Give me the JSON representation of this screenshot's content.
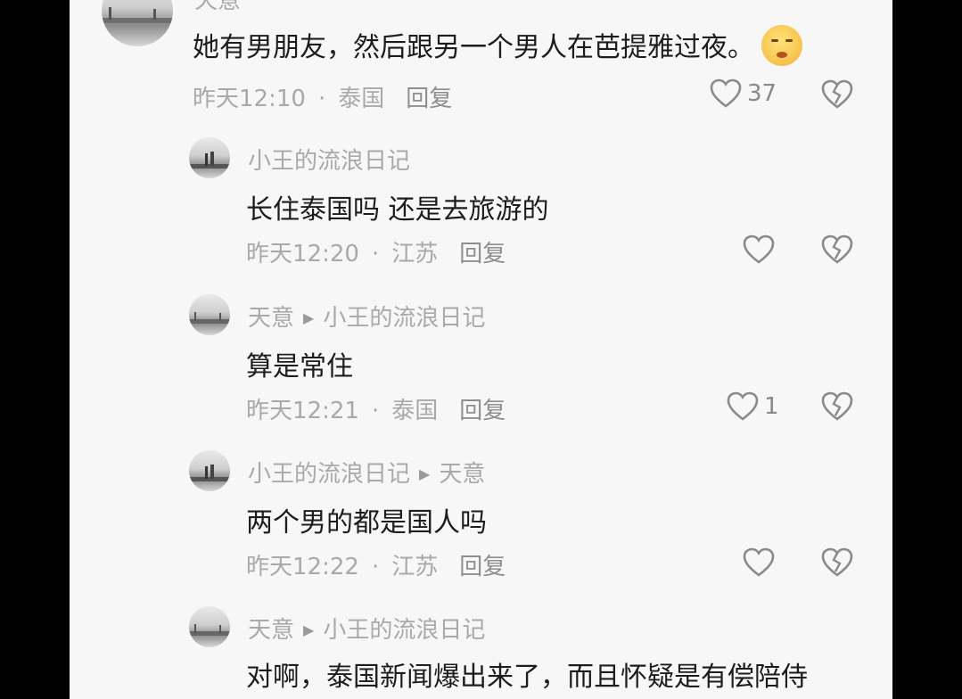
{
  "comments": [
    {
      "name": "天意",
      "text": "她有男朋友，然后跟另一个男人在芭提雅过夜。",
      "time": "昨天12:10",
      "location": "泰国",
      "reply": "回复",
      "likes": "37",
      "emoji": "grimace-emoji"
    },
    {
      "name": "小王的流浪日记",
      "text": "长住泰国吗 还是去旅游的",
      "time": "昨天12:20",
      "location": "江苏",
      "reply": "回复",
      "likes": ""
    },
    {
      "name": "天意",
      "reply_to": "小王的流浪日记",
      "text": "算是常住",
      "time": "昨天12:21",
      "location": "泰国",
      "reply": "回复",
      "likes": "1"
    },
    {
      "name": "小王的流浪日记",
      "reply_to": "天意",
      "text": "两个男的都是国人吗",
      "time": "昨天12:22",
      "location": "江苏",
      "reply": "回复",
      "likes": ""
    },
    {
      "name": "天意",
      "reply_to": "小王的流浪日记",
      "text": "对啊，泰国新闻爆出来了，而且怀疑是有偿陪侍"
    }
  ],
  "separator": "·",
  "icons": {
    "like": "heart-outline-icon",
    "dislike": "broken-heart-icon",
    "reply_arrow": "triangle-right-icon"
  }
}
